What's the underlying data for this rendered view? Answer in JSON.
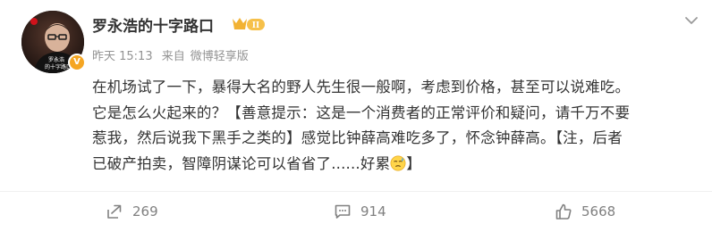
{
  "post": {
    "author": {
      "name": "罗永浩的十字路口",
      "vip_level": "II",
      "avatar_caption_line1": "罗永浩",
      "avatar_caption_line2": "的十字路口"
    },
    "meta": {
      "time": "昨天 15:13",
      "from_label": "来自",
      "source": "微博轻享版"
    },
    "content": {
      "line1": "在机场试了一下，暴得大名的野人先生很一般啊，考虑到价格，甚至可以说难吃。",
      "line2": "它是怎么火起来的？【善意提示：这是一个消费者的正常评价和疑问，请千万不要",
      "line3": "惹我，然后说我下黑手之类的】感觉比钟薛高难吃多了，怀念钟薛高。【注，后者",
      "line4_text": "已破产拍卖，智障阴谋论可以省省了......好累",
      "line4_end": "】"
    },
    "actions": {
      "reposts": "269",
      "comments": "914",
      "likes": "5668"
    },
    "colors": {
      "text": "#333333",
      "meta": "#939393",
      "action": "#808080",
      "verified": "#f5a623"
    },
    "icons": [
      "avatar",
      "verified-icon",
      "vip-badge-icon",
      "chevron-down-icon",
      "sweat-emoji-icon",
      "repost-icon",
      "comment-icon",
      "like-icon"
    ]
  }
}
